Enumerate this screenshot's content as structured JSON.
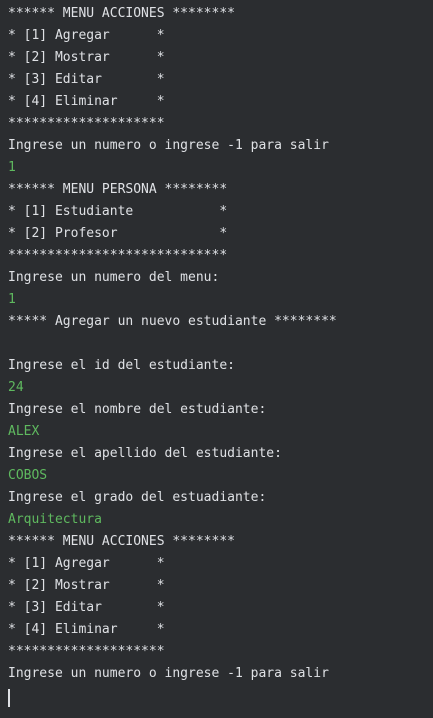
{
  "console": {
    "colors": {
      "background": "#2b2d30",
      "output_text": "#dfe1e5",
      "user_input_text": "#5fb95f"
    },
    "lines": [
      {
        "text": "****** MENU ACCIONES ********",
        "type": "output"
      },
      {
        "text": "* [1] Agregar      *",
        "type": "output"
      },
      {
        "text": "* [2] Mostrar      *",
        "type": "output"
      },
      {
        "text": "* [3] Editar       *",
        "type": "output"
      },
      {
        "text": "* [4] Eliminar     *",
        "type": "output"
      },
      {
        "text": "********************",
        "type": "output"
      },
      {
        "text": "Ingrese un numero o ingrese -1 para salir",
        "type": "output"
      },
      {
        "text": "1",
        "type": "input"
      },
      {
        "text": "****** MENU PERSONA ********",
        "type": "output"
      },
      {
        "text": "* [1] Estudiante           *",
        "type": "output"
      },
      {
        "text": "* [2] Profesor             *",
        "type": "output"
      },
      {
        "text": "****************************",
        "type": "output"
      },
      {
        "text": "Ingrese un numero del menu:",
        "type": "output"
      },
      {
        "text": "1",
        "type": "input"
      },
      {
        "text": "***** Agregar un nuevo estudiante ********",
        "type": "output"
      },
      {
        "text": "",
        "type": "blank"
      },
      {
        "text": "Ingrese el id del estudiante:",
        "type": "output"
      },
      {
        "text": "24",
        "type": "input"
      },
      {
        "text": "Ingrese el nombre del estudiante:",
        "type": "output"
      },
      {
        "text": "ALEX",
        "type": "input"
      },
      {
        "text": "Ingrese el apellido del estudiante:",
        "type": "output"
      },
      {
        "text": "COBOS",
        "type": "input"
      },
      {
        "text": "Ingrese el grado del estuadiante:",
        "type": "output"
      },
      {
        "text": "Arquitectura",
        "type": "input"
      },
      {
        "text": "****** MENU ACCIONES ********",
        "type": "output"
      },
      {
        "text": "* [1] Agregar      *",
        "type": "output"
      },
      {
        "text": "* [2] Mostrar      *",
        "type": "output"
      },
      {
        "text": "* [3] Editar       *",
        "type": "output"
      },
      {
        "text": "* [4] Eliminar     *",
        "type": "output"
      },
      {
        "text": "********************",
        "type": "output"
      },
      {
        "text": "Ingrese un numero o ingrese -1 para salir",
        "type": "output"
      }
    ]
  }
}
